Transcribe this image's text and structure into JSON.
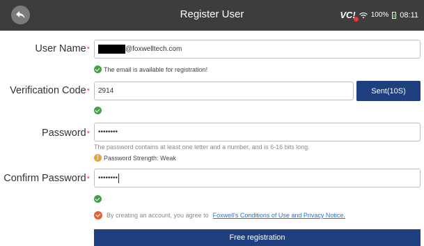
{
  "header": {
    "title": "Register User",
    "vci_label": "VC!",
    "battery": "100%",
    "time": "08:11"
  },
  "form": {
    "username": {
      "label": "User Name",
      "value": "@foxwelltech.com",
      "hint": "The email is available for registration!"
    },
    "verification": {
      "label": "Verification Code",
      "value": "2914",
      "button": "Sent(10S)"
    },
    "password": {
      "label": "Password",
      "value": "••••••••",
      "rule": "The password contains at least one letter and a number, and is 6-16 bits long.",
      "strength": "Password Strength: Weak"
    },
    "confirm": {
      "label": "Confirm Password",
      "value": "••••••••"
    },
    "required_mark": "*"
  },
  "agreement": {
    "text": "By creating an account, you agree to",
    "link": "Foxwell's Conditions of Use and Privacy Notice."
  },
  "submit_label": "Free registration",
  "colors": {
    "header_bg": "#3d3d3d",
    "primary": "#1f3f7f",
    "ok": "#43a047",
    "warn": "#f0a030",
    "required": "#e53935"
  }
}
